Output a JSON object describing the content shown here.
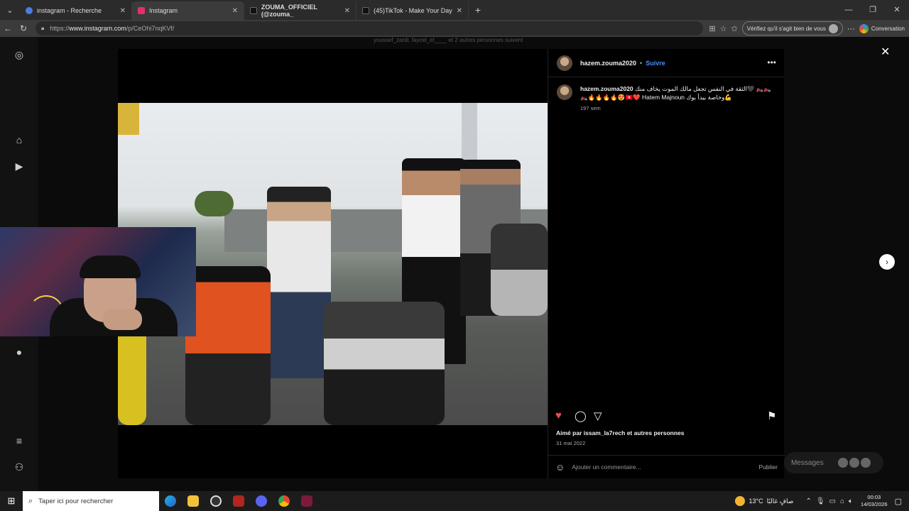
{
  "browser": {
    "tabs": [
      {
        "title": "instagram - Recherche",
        "active": false,
        "favicon_color": "#4a7de3"
      },
      {
        "title": "Instagram",
        "active": true,
        "favicon_color": "#e1306c"
      },
      {
        "title": "ZOUMA_OFFICIEL (@zouma_",
        "active": false,
        "favicon_color": "#111111"
      },
      {
        "title": "(45)TikTok - Make Your Day",
        "active": false,
        "favicon_color": "#111111"
      }
    ],
    "url_prefix": "https://",
    "url_domain": "www.instagram.com",
    "url_path": "/p/CeOhi7nqKVf/",
    "verify_label": "Vérifiez qu'il s'agit bien de vous",
    "conversation_label": "Conversation"
  },
  "page": {
    "suggestion_text": "youssef_zardi, faycel_el____ et 2 autres personnes suivent",
    "post": {
      "author": "hazem.zouma2020",
      "follow_label": "Suivre",
      "caption_user": "hazem.zouma2020",
      "caption_text": "الثقة في النفس تجعل مالك الموت يخاف منك🖤 🏍️🏍️🏍️🔥🔥🔥🔥😍🇹🇳❤️ Hatem Majnoun وخاصة بيدأ بوك💪",
      "caption_time": "197 sem",
      "likes_text": "Aimé par issam_la7rech et autres personnes",
      "date": "31 mai 2022",
      "comment_placeholder": "Ajouter un commentaire...",
      "publish_label": "Publier"
    },
    "messages_label": "Messages",
    "colors": {
      "like": "#ed4956",
      "follow": "#4d8ff0"
    }
  },
  "taskbar": {
    "search_placeholder": "Taper ici pour rechercher",
    "weather_temp": "13°C",
    "weather_desc": "صافٍ غالبًا",
    "time": "00:03",
    "date": "14/03/2026"
  }
}
